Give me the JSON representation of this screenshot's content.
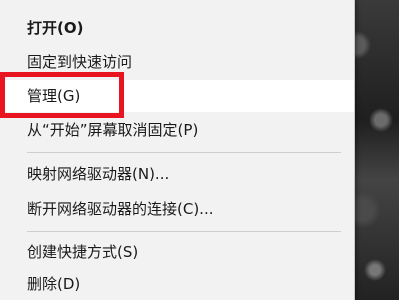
{
  "menu": {
    "items": [
      {
        "label": "打开(O)"
      },
      {
        "label": "固定到快速访问"
      },
      {
        "label": "管理(G)"
      },
      {
        "label": "从“开始”屏幕取消固定(P)"
      },
      {
        "label": "映射网络驱动器(N)..."
      },
      {
        "label": "断开网络驱动器的连接(C)..."
      },
      {
        "label": "创建快捷方式(S)"
      },
      {
        "label": "删除(D)"
      }
    ]
  },
  "colors": {
    "menu_background": "#f2f2f2",
    "hover_background": "#ffffff",
    "annotation_border": "#e8141f"
  }
}
